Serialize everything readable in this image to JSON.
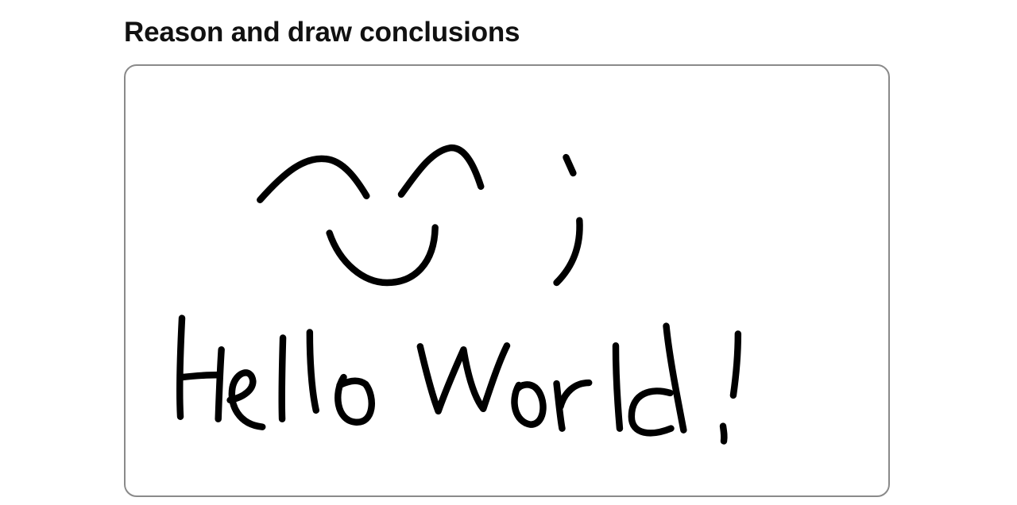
{
  "section": {
    "title": "Reason and draw conclusions"
  },
  "drawing": {
    "content_description_hidden": true,
    "ink_color": "#000000",
    "handwritten_text": "Hello World!"
  }
}
